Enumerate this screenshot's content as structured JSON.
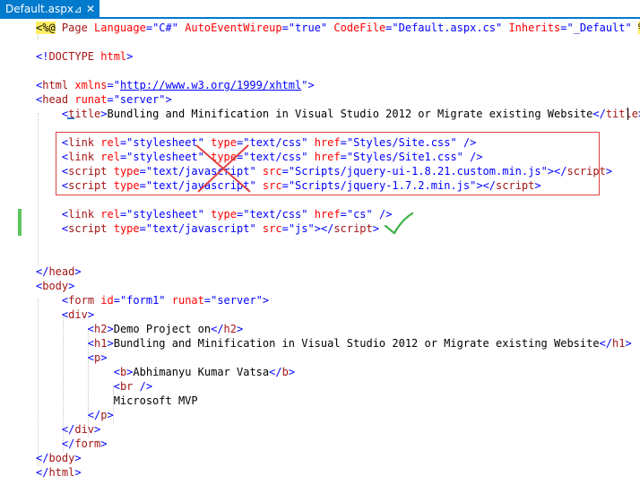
{
  "tab": {
    "title": "Default.aspx",
    "pin": "⊿",
    "close": "✕"
  },
  "code_lines": [
    [
      {
        "t": "<%@",
        "c": "dir"
      },
      {
        "t": " Page ",
        "c": "tn"
      },
      {
        "t": "Language",
        "c": "at"
      },
      {
        "t": "=\"C#\" ",
        "c": "va"
      },
      {
        "t": "AutoEventWireup",
        "c": "at"
      },
      {
        "t": "=\"true\" ",
        "c": "va"
      },
      {
        "t": "CodeFile",
        "c": "at"
      },
      {
        "t": "=\"Default.aspx.cs\" ",
        "c": "va"
      },
      {
        "t": "Inherits",
        "c": "at"
      },
      {
        "t": "=\"_Default\" ",
        "c": "va"
      },
      {
        "t": "%>",
        "c": "dir"
      }
    ],
    [],
    [
      {
        "t": "<!",
        "c": "tg"
      },
      {
        "t": "DOCTYPE ",
        "c": "tn"
      },
      {
        "t": "html",
        "c": "at"
      },
      {
        "t": ">",
        "c": "tg"
      }
    ],
    [],
    [
      {
        "t": "<",
        "c": "tg"
      },
      {
        "t": "html ",
        "c": "tn"
      },
      {
        "t": "xmlns",
        "c": "at"
      },
      {
        "t": "=\"",
        "c": "va"
      },
      {
        "t": "http://www.w3.org/1999/xhtml",
        "c": "url"
      },
      {
        "t": "\">",
        "c": "va"
      }
    ],
    [
      {
        "t": "<",
        "c": "tg"
      },
      {
        "t": "head ",
        "c": "tn"
      },
      {
        "t": "runat",
        "c": "at"
      },
      {
        "t": "=\"server\">",
        "c": "va"
      }
    ],
    [
      {
        "t": "    "
      },
      {
        "t": "<",
        "c": "tg"
      },
      {
        "t": "title",
        "c": "tn"
      },
      {
        "t": ">",
        "c": "tg"
      },
      {
        "t": "Bundling and Minification in Visual Studio 2012 or Migrate existing Website",
        "c": "tx"
      },
      {
        "t": "</",
        "c": "tg"
      },
      {
        "t": "title",
        "c": "tn"
      },
      {
        "t": ">",
        "c": "tg"
      }
    ],
    [],
    [
      {
        "t": "    "
      },
      {
        "t": "<",
        "c": "tg"
      },
      {
        "t": "link ",
        "c": "tn"
      },
      {
        "t": "rel",
        "c": "at"
      },
      {
        "t": "=\"stylesheet\" ",
        "c": "va"
      },
      {
        "t": "type",
        "c": "at"
      },
      {
        "t": "=\"text/css\" ",
        "c": "va"
      },
      {
        "t": "href",
        "c": "at"
      },
      {
        "t": "=\"Styles/Site.css\" ",
        "c": "va"
      },
      {
        "t": "/>",
        "c": "tg"
      }
    ],
    [
      {
        "t": "    "
      },
      {
        "t": "<",
        "c": "tg"
      },
      {
        "t": "link ",
        "c": "tn"
      },
      {
        "t": "rel",
        "c": "at"
      },
      {
        "t": "=\"stylesheet\" ",
        "c": "va"
      },
      {
        "t": "type",
        "c": "at"
      },
      {
        "t": "=\"text/css\" ",
        "c": "va"
      },
      {
        "t": "href",
        "c": "at"
      },
      {
        "t": "=\"Styles/Site1.css\" ",
        "c": "va"
      },
      {
        "t": "/>",
        "c": "tg"
      }
    ],
    [
      {
        "t": "    "
      },
      {
        "t": "<",
        "c": "tg"
      },
      {
        "t": "script ",
        "c": "tn"
      },
      {
        "t": "type",
        "c": "at"
      },
      {
        "t": "=\"text/javascript\" ",
        "c": "va"
      },
      {
        "t": "src",
        "c": "at"
      },
      {
        "t": "=\"Scripts/jquery-ui-1.8.21.custom.min.js\">",
        "c": "va"
      },
      {
        "t": "</",
        "c": "tg"
      },
      {
        "t": "script",
        "c": "tn"
      },
      {
        "t": ">",
        "c": "tg"
      }
    ],
    [
      {
        "t": "    "
      },
      {
        "t": "<",
        "c": "tg"
      },
      {
        "t": "script ",
        "c": "tn"
      },
      {
        "t": "type",
        "c": "at"
      },
      {
        "t": "=\"text/javascript\" ",
        "c": "va"
      },
      {
        "t": "src",
        "c": "at"
      },
      {
        "t": "=\"Scripts/jquery-1.7.2.min.js\">",
        "c": "va"
      },
      {
        "t": "</",
        "c": "tg"
      },
      {
        "t": "script",
        "c": "tn"
      },
      {
        "t": ">",
        "c": "tg"
      }
    ],
    [],
    [
      {
        "t": "    "
      },
      {
        "t": "<",
        "c": "tg"
      },
      {
        "t": "link ",
        "c": "tn"
      },
      {
        "t": "rel",
        "c": "at"
      },
      {
        "t": "=\"stylesheet\" ",
        "c": "va"
      },
      {
        "t": "type",
        "c": "at"
      },
      {
        "t": "=\"text/css\" ",
        "c": "va"
      },
      {
        "t": "href",
        "c": "at"
      },
      {
        "t": "=\"cs\" ",
        "c": "va"
      },
      {
        "t": "/>",
        "c": "tg"
      }
    ],
    [
      {
        "t": "    "
      },
      {
        "t": "<",
        "c": "tg"
      },
      {
        "t": "script ",
        "c": "tn"
      },
      {
        "t": "type",
        "c": "at"
      },
      {
        "t": "=\"text/javascript\" ",
        "c": "va"
      },
      {
        "t": "src",
        "c": "at"
      },
      {
        "t": "=\"js\">",
        "c": "va"
      },
      {
        "t": "</",
        "c": "tg"
      },
      {
        "t": "script",
        "c": "tn"
      },
      {
        "t": ">",
        "c": "tg"
      }
    ],
    [],
    [],
    [
      {
        "t": "</",
        "c": "tg"
      },
      {
        "t": "head",
        "c": "tn"
      },
      {
        "t": ">",
        "c": "tg"
      }
    ],
    [
      {
        "t": "<",
        "c": "tg"
      },
      {
        "t": "body",
        "c": "tn"
      },
      {
        "t": ">",
        "c": "tg"
      }
    ],
    [
      {
        "t": "    "
      },
      {
        "t": "<",
        "c": "tg"
      },
      {
        "t": "form ",
        "c": "tn"
      },
      {
        "t": "id",
        "c": "at"
      },
      {
        "t": "=\"form1\" ",
        "c": "va"
      },
      {
        "t": "runat",
        "c": "at"
      },
      {
        "t": "=\"server\">",
        "c": "va"
      }
    ],
    [
      {
        "t": "    "
      },
      {
        "t": "<",
        "c": "tg"
      },
      {
        "t": "div",
        "c": "tn"
      },
      {
        "t": ">",
        "c": "tg"
      }
    ],
    [
      {
        "t": "        "
      },
      {
        "t": "<",
        "c": "tg"
      },
      {
        "t": "h2",
        "c": "tn"
      },
      {
        "t": ">",
        "c": "tg"
      },
      {
        "t": "Demo Project on",
        "c": "tx"
      },
      {
        "t": "</",
        "c": "tg"
      },
      {
        "t": "h2",
        "c": "tn"
      },
      {
        "t": ">",
        "c": "tg"
      }
    ],
    [
      {
        "t": "        "
      },
      {
        "t": "<",
        "c": "tg"
      },
      {
        "t": "h1",
        "c": "tn"
      },
      {
        "t": ">",
        "c": "tg"
      },
      {
        "t": "Bundling and Minification in Visual Studio 2012 or Migrate existing Website",
        "c": "tx"
      },
      {
        "t": "</",
        "c": "tg"
      },
      {
        "t": "h1",
        "c": "tn"
      },
      {
        "t": ">",
        "c": "tg"
      }
    ],
    [
      {
        "t": "        "
      },
      {
        "t": "<",
        "c": "tg"
      },
      {
        "t": "p",
        "c": "tn"
      },
      {
        "t": ">",
        "c": "tg"
      }
    ],
    [
      {
        "t": "            "
      },
      {
        "t": "<",
        "c": "tg"
      },
      {
        "t": "b",
        "c": "tn"
      },
      {
        "t": ">",
        "c": "tg"
      },
      {
        "t": "Abhimanyu Kumar Vatsa",
        "c": "tx"
      },
      {
        "t": "</",
        "c": "tg"
      },
      {
        "t": "b",
        "c": "tn"
      },
      {
        "t": ">",
        "c": "tg"
      }
    ],
    [
      {
        "t": "            "
      },
      {
        "t": "<",
        "c": "tg"
      },
      {
        "t": "br ",
        "c": "tn"
      },
      {
        "t": "/>",
        "c": "tg"
      }
    ],
    [
      {
        "t": "            "
      },
      {
        "t": "Microsoft MVP",
        "c": "tx"
      }
    ],
    [
      {
        "t": "        "
      },
      {
        "t": "</",
        "c": "tg"
      },
      {
        "t": "p",
        "c": "tn"
      },
      {
        "t": ">",
        "c": "tg"
      }
    ],
    [
      {
        "t": "    "
      },
      {
        "t": "</",
        "c": "tg"
      },
      {
        "t": "div",
        "c": "tn"
      },
      {
        "t": ">",
        "c": "tg"
      }
    ],
    [
      {
        "t": "    "
      },
      {
        "t": "</",
        "c": "tg"
      },
      {
        "t": "form",
        "c": "tn"
      },
      {
        "t": ">",
        "c": "tg"
      }
    ],
    [
      {
        "t": "</",
        "c": "tg"
      },
      {
        "t": "body",
        "c": "tn"
      },
      {
        "t": ">",
        "c": "tg"
      }
    ],
    [
      {
        "t": "</",
        "c": "tg"
      },
      {
        "t": "html",
        "c": "tn"
      },
      {
        "t": ">",
        "c": "tg"
      }
    ]
  ],
  "annotations": {
    "box_color": "#e04040",
    "x_color": "#e04040",
    "check_color": "#3cb043"
  }
}
